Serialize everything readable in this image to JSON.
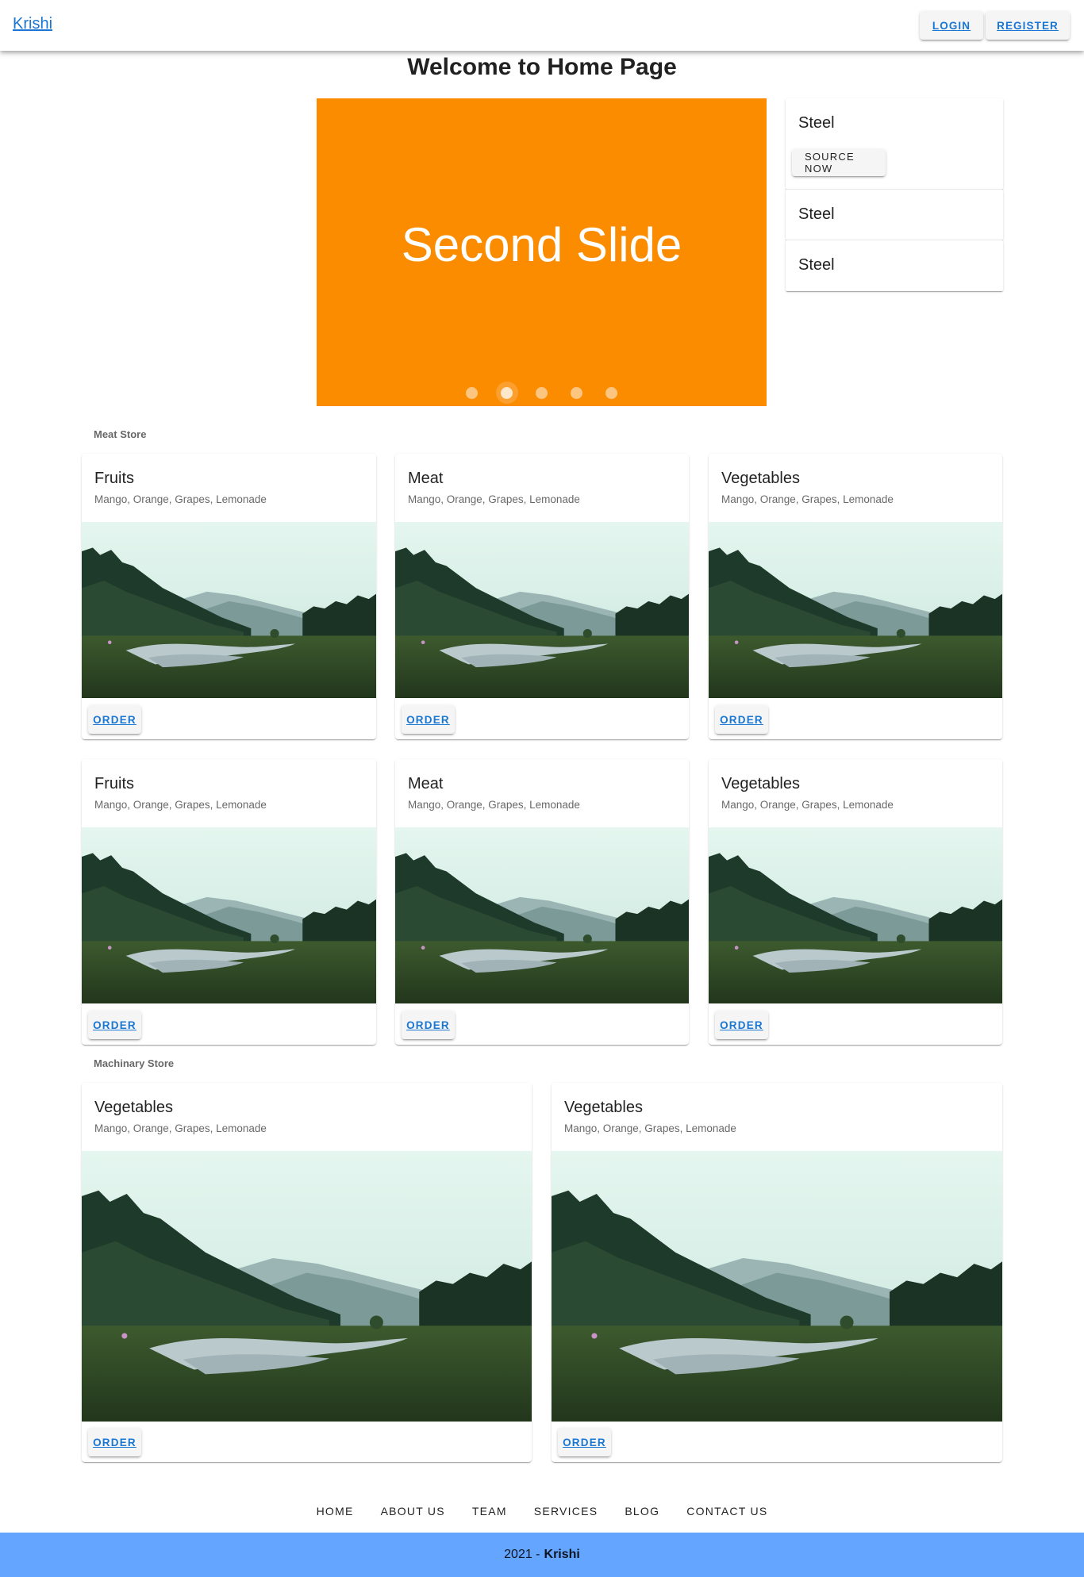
{
  "header": {
    "brand": "Krishi",
    "login_label": "LOGIN",
    "register_label": "REGISTER"
  },
  "page_title": "Welcome to Home Page",
  "slider": {
    "current_text": "Second Slide",
    "slide_count": 5,
    "active_index": 1,
    "color": "#fb8c00"
  },
  "side_list": {
    "items": [
      {
        "title": "Steel",
        "action": "SOURCE NOW"
      },
      {
        "title": "Steel"
      },
      {
        "title": "Steel"
      }
    ]
  },
  "sections": [
    {
      "label": "Meat Store",
      "cards": [
        {
          "title": "Fruits",
          "subtitle": "Mango, Orange, Grapes, Lemonade",
          "action": "ORDER"
        },
        {
          "title": "Meat",
          "subtitle": "Mango, Orange, Grapes, Lemonade",
          "action": "ORDER"
        },
        {
          "title": "Vegetables",
          "subtitle": "Mango, Orange, Grapes, Lemonade",
          "action": "ORDER"
        },
        {
          "title": "Fruits",
          "subtitle": "Mango, Orange, Grapes, Lemonade",
          "action": "ORDER"
        },
        {
          "title": "Meat",
          "subtitle": "Mango, Orange, Grapes, Lemonade",
          "action": "ORDER"
        },
        {
          "title": "Vegetables",
          "subtitle": "Mango, Orange, Grapes, Lemonade",
          "action": "ORDER"
        }
      ]
    },
    {
      "label": "Machinary Store",
      "cards": [
        {
          "title": "Vegetables",
          "subtitle": "Mango, Orange, Grapes, Lemonade",
          "action": "ORDER"
        },
        {
          "title": "Vegetables",
          "subtitle": "Mango, Orange, Grapes, Lemonade",
          "action": "ORDER"
        }
      ]
    }
  ],
  "footer": {
    "links": [
      "HOME",
      "ABOUT US",
      "TEAM",
      "SERVICES",
      "BLOG",
      "CONTACT US"
    ],
    "copyright_year": "2021 -",
    "copyright_brand": "Krishi",
    "bar_color": "#64a5ff"
  }
}
